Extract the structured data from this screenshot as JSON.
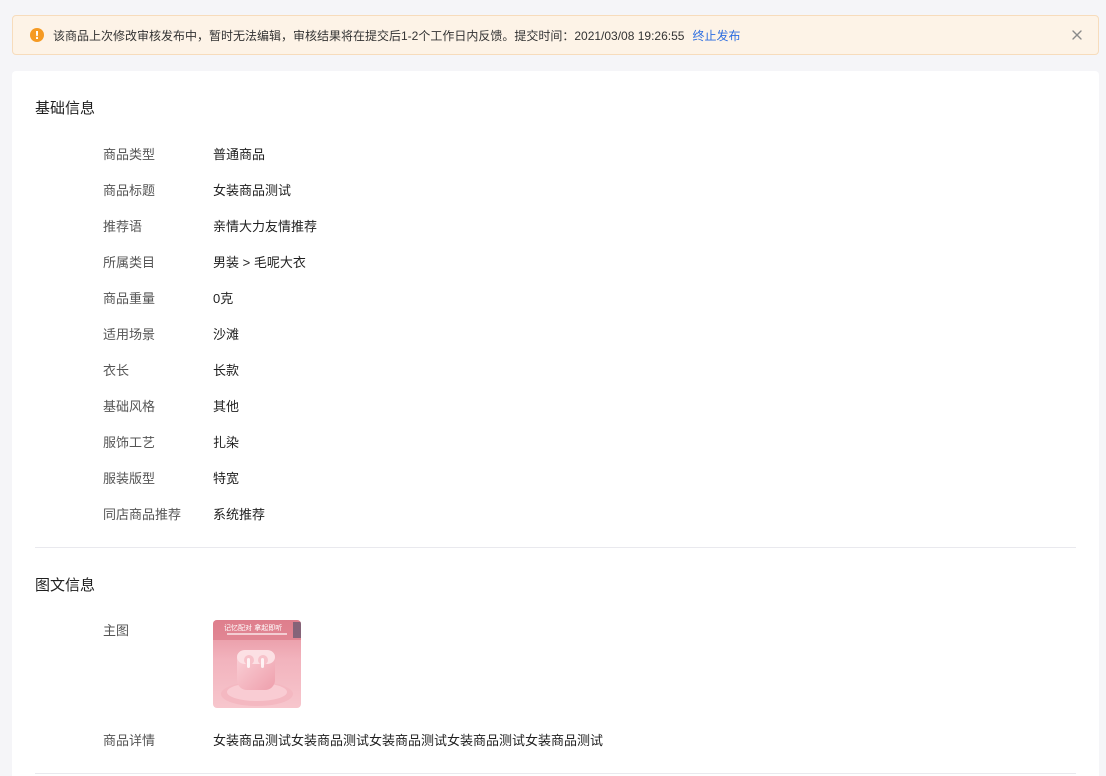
{
  "notice": {
    "icon": "warning-circle-icon",
    "text": "该商品上次修改审核发布中，暂时无法编辑，审核结果将在提交后1-2个工作日内反馈。提交时间：2021/03/08 19:26:55",
    "action_label": "终止发布",
    "close_icon": "close-icon",
    "color_accent": "#f59a23",
    "color_link": "#2d6ee0"
  },
  "basic": {
    "title": "基础信息",
    "fields": [
      {
        "label": "商品类型",
        "value": "普通商品"
      },
      {
        "label": "商品标题",
        "value": "女装商品测试"
      },
      {
        "label": "推荐语",
        "value": "亲情大力友情推荐"
      },
      {
        "label": "所属类目",
        "value": "男装 > 毛呢大衣"
      },
      {
        "label": "商品重量",
        "value": "0克"
      },
      {
        "label": "适用场景",
        "value": "沙滩"
      },
      {
        "label": "衣长",
        "value": "长款"
      },
      {
        "label": "基础风格",
        "value": "其他"
      },
      {
        "label": "服饰工艺",
        "value": "扎染"
      },
      {
        "label": "服装版型",
        "value": "特宽"
      },
      {
        "label": "同店商品推荐",
        "value": "系统推荐"
      }
    ]
  },
  "media": {
    "title": "图文信息",
    "main_image_label": "主图",
    "main_image_caption": "记忆配对 拿起即听",
    "detail_label": "商品详情",
    "detail_value": "女装商品测试女装商品测试女装商品测试女装商品测试女装商品测试"
  }
}
